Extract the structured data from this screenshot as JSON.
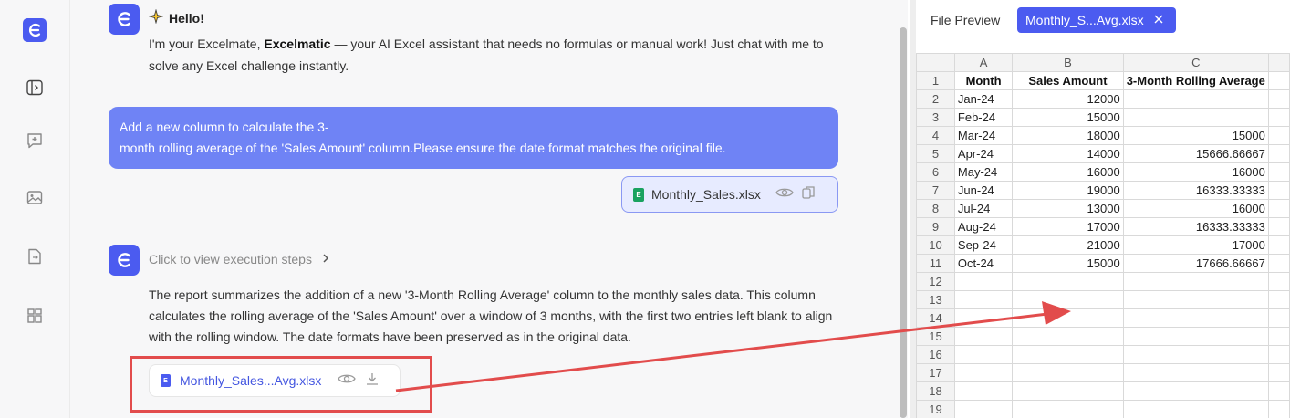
{
  "rail": {
    "logo_letter": "E",
    "items": [
      "logo-icon",
      "sidebar-toggle-icon",
      "new-chat-icon",
      "image-icon",
      "file-icon",
      "apps-icon"
    ]
  },
  "chat": {
    "greeting": "Hello!",
    "intro_prefix": "I'm your Excelmate, ",
    "intro_bold": "Excelmatic",
    "intro_suffix": " — your AI Excel assistant that needs no formulas or manual work! Just chat with me to solve any Excel challenge instantly.",
    "user_message_line1": "Add a new column to calculate the 3-",
    "user_message_line2": "month rolling average of the 'Sales Amount' column.Please ensure the date format matches the original file.",
    "attachment_name": "Monthly_Sales.xlsx",
    "steps_label": "Click to view execution steps",
    "report_text": "The report summarizes the addition of a new '3-Month Rolling Average' column to the monthly sales data. This column calculates the rolling average of the 'Sales Amount' over a window of 3 months, with the first two entries left blank to align with the rolling window. The date formats have been preserved as in the original data.",
    "result_file_name": "Monthly_Sales...Avg.xlsx"
  },
  "preview": {
    "label": "File Preview",
    "tab_name": "Monthly_S...Avg.xlsx",
    "columns": [
      "A",
      "B",
      "C"
    ],
    "headers": [
      "Month",
      "Sales Amount",
      "3-Month Rolling Average"
    ],
    "rows": [
      [
        "Jan-24",
        "12000",
        ""
      ],
      [
        "Feb-24",
        "15000",
        ""
      ],
      [
        "Mar-24",
        "18000",
        "15000"
      ],
      [
        "Apr-24",
        "14000",
        "15666.66667"
      ],
      [
        "May-24",
        "16000",
        "16000"
      ],
      [
        "Jun-24",
        "19000",
        "16333.33333"
      ],
      [
        "Jul-24",
        "13000",
        "16000"
      ],
      [
        "Aug-24",
        "17000",
        "16333.33333"
      ],
      [
        "Sep-24",
        "21000",
        "17000"
      ],
      [
        "Oct-24",
        "15000",
        "17666.66667"
      ]
    ],
    "row_numbers": [
      "1",
      "2",
      "3",
      "4",
      "5",
      "6",
      "7",
      "8",
      "9",
      "10",
      "11",
      "12",
      "13",
      "14",
      "15",
      "16",
      "17",
      "18",
      "19"
    ]
  },
  "colors": {
    "accent": "#4b5bf0",
    "annotation": "#e24c4c",
    "user_bubble": "#6f83f5"
  }
}
